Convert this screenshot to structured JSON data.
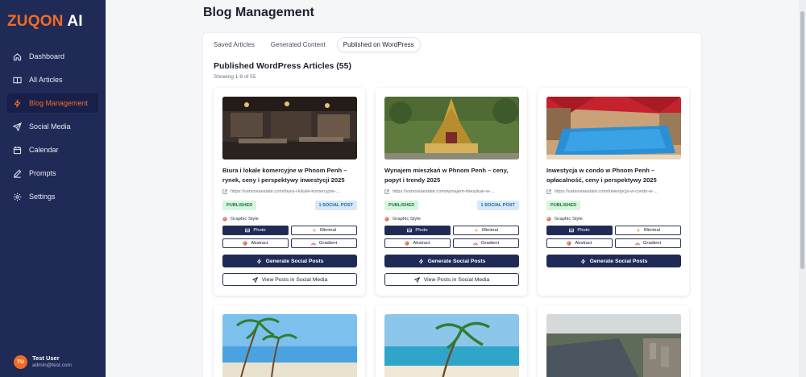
{
  "app": {
    "brand": "ZUQON",
    "brand_suffix": "AI"
  },
  "sidebar": {
    "items": [
      {
        "label": "Dashboard",
        "icon": "home-icon"
      },
      {
        "label": "All Articles",
        "icon": "book-icon"
      },
      {
        "label": "Blog Management",
        "icon": "lightning-icon",
        "active": true
      },
      {
        "label": "Social Media",
        "icon": "send-icon"
      },
      {
        "label": "Calendar",
        "icon": "calendar-icon"
      },
      {
        "label": "Prompts",
        "icon": "pencil-icon"
      },
      {
        "label": "Settings",
        "icon": "gear-icon"
      }
    ],
    "user": {
      "initials": "TU",
      "name": "Test User",
      "email": "admin@test.com"
    }
  },
  "page": {
    "title": "Blog Management"
  },
  "tabs": [
    "Saved Articles",
    "Generated Content",
    "Published on WordPress"
  ],
  "section": {
    "title": "Published WordPress Articles (55)",
    "subtitle": "Showing 1-9 of 55"
  },
  "style_labels": {
    "heading": "Graphic Style",
    "photo": "Photo",
    "minimal": "Minimal",
    "abstract": "Abstract",
    "gradient": "Gradient"
  },
  "actions": {
    "generate": "Generate Social Posts",
    "view": "View Posts in Social Media"
  },
  "cards": [
    {
      "title": "Biura i lokale komercyjne w Phnom Penh – rynek, ceny i perspektywy inwestycji 2025",
      "url": "https://varsoviaestate.com/biura-i-lokale-komercyjne-...",
      "status": "PUBLISHED",
      "social": "1 SOCIAL POST"
    },
    {
      "title": "Wynajem mieszkań w Phnom Penh – ceny, popyt i trendy 2025",
      "url": "https://varsoviaestate.com/wynajem-mieszkan-w-...",
      "status": "PUBLISHED",
      "social": "1 SOCIAL POST"
    },
    {
      "title": "Inwestycja w condo w Phnom Penh – opłacalność, ceny i perspektywy 2025",
      "url": "https://varsoviaestate.com/inwestycja-w-condo-w-...",
      "status": "PUBLISHED",
      "social": ""
    }
  ],
  "colors": {
    "sidebar": "#1f2a56",
    "accent": "#f26b23",
    "published_bg": "#d7f5df",
    "social_bg": "#d6e9fb"
  }
}
